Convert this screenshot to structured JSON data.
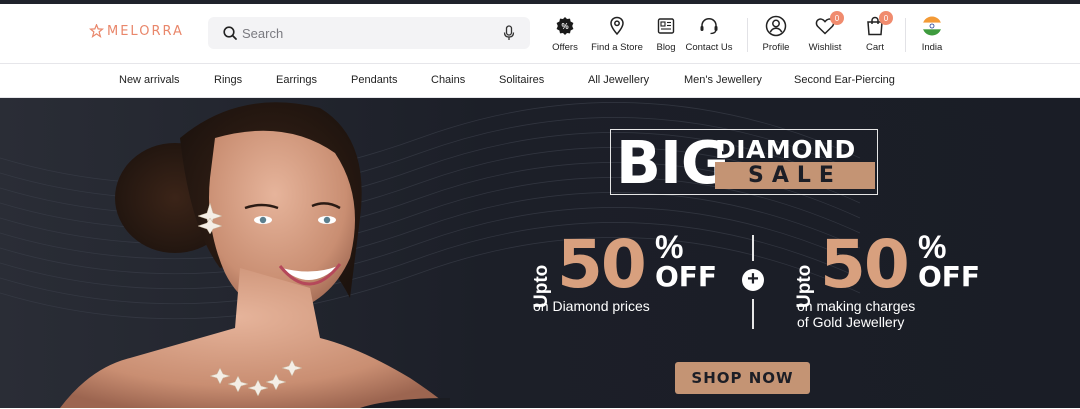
{
  "brand": {
    "name": "MELORRA",
    "accent": "#e9876b"
  },
  "search": {
    "placeholder": "Search"
  },
  "header_items": [
    {
      "label": "Offers",
      "icon": "offers-badge-icon"
    },
    {
      "label": "Find a Store",
      "icon": "location-pin-icon"
    },
    {
      "label": "Blog",
      "icon": "blog-icon"
    },
    {
      "label": "Contact Us",
      "icon": "headset-icon"
    },
    {
      "label": "Profile",
      "icon": "user-icon"
    },
    {
      "label": "Wishlist",
      "icon": "heart-icon",
      "badge": "0"
    },
    {
      "label": "Cart",
      "icon": "shopping-bag-icon",
      "badge": "0"
    },
    {
      "label": "India",
      "icon": "india-flag-icon"
    }
  ],
  "nav": [
    "New arrivals",
    "Rings",
    "Earrings",
    "Pendants",
    "Chains",
    "Solitaires",
    "All Jewellery",
    "Men's Jewellery",
    "Second Ear-Piercing"
  ],
  "hero": {
    "headline_big": "BIG",
    "headline_diamond": "DIAMOND",
    "headline_sale": "SALE",
    "offer1": {
      "prefix": "Upto",
      "value": "50",
      "percent": "%",
      "suffix": "OFF",
      "desc1": "on Diamond prices",
      "desc2": ""
    },
    "offer2": {
      "prefix": "Upto",
      "value": "50",
      "percent": "%",
      "suffix": "OFF",
      "desc1": "on making charges",
      "desc2": "of Gold Jewellery"
    },
    "plus": "+",
    "cta": "SHOP NOW",
    "colors": {
      "background": "#1b1e27",
      "gold": "#d8a07e",
      "button": "#c49474"
    }
  }
}
